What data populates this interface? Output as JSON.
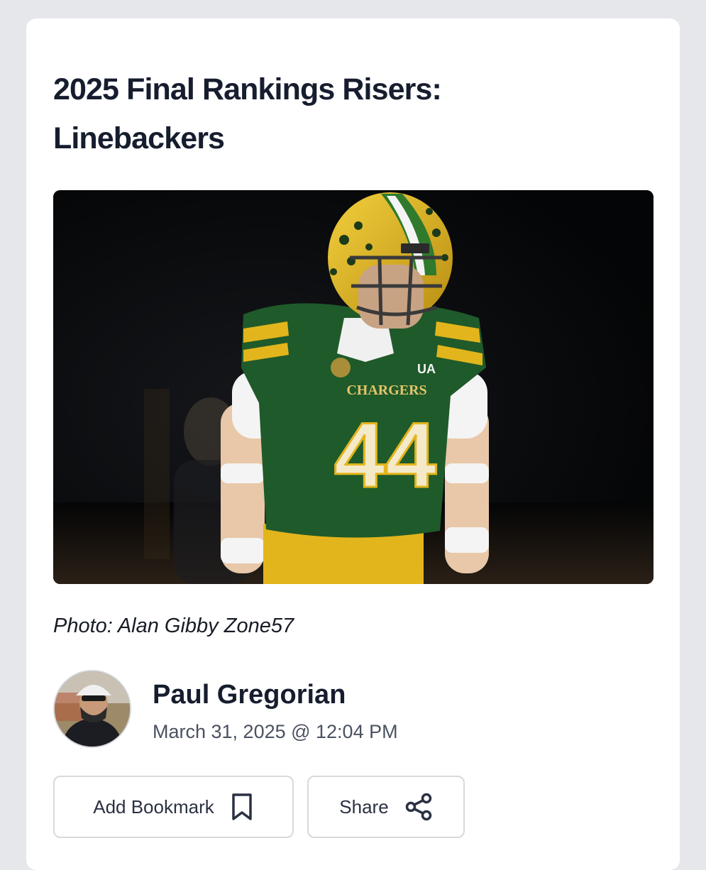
{
  "article": {
    "title": "2025 Final Rankings Risers: Linebackers",
    "photo_caption": "Photo: Alan Gibby Zone57",
    "photo": {
      "jersey_text": "CHARGERS",
      "jersey_number": "44",
      "colors": {
        "jersey": "#1f5a2a",
        "accent": "#e8b91f",
        "background": "#050608"
      }
    }
  },
  "author": {
    "name": "Paul Gregorian",
    "date": "March 31, 2025 @ 12:04 PM"
  },
  "actions": {
    "bookmark_label": "Add Bookmark",
    "share_label": "Share"
  }
}
